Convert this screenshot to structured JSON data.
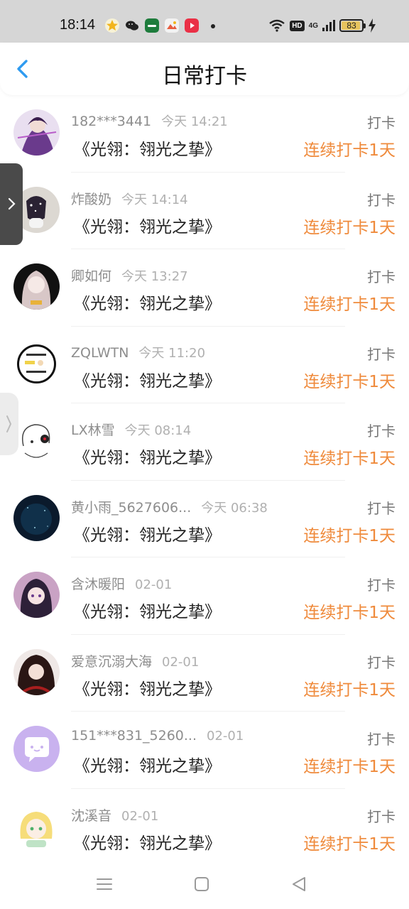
{
  "status_bar": {
    "time": "18:14",
    "battery": "83",
    "network": "4G",
    "hd": "HD",
    "app_icons": [
      "star-icon",
      "wechat-icon",
      "oppo-icon",
      "gallery-icon",
      "video-icon"
    ]
  },
  "header": {
    "title": "日常打卡",
    "back_icon": "chevron-left-icon"
  },
  "colors": {
    "accent_blue": "#2f9bf0",
    "streak_orange": "#ef8a3b"
  },
  "checkins": [
    {
      "name": "182***3441",
      "time": "今天 14:21",
      "book": "《光翎：翎光之挚》",
      "tag": "打卡",
      "streak": "连续打卡1天"
    },
    {
      "name": "炸酸奶",
      "time": "今天 14:14",
      "book": "《光翎：翎光之挚》",
      "tag": "打卡",
      "streak": "连续打卡1天"
    },
    {
      "name": "卿如何",
      "time": "今天 13:27",
      "book": "《光翎：翎光之挚》",
      "tag": "打卡",
      "streak": "连续打卡1天"
    },
    {
      "name": "ZQLWTN",
      "time": "今天 11:20",
      "book": "《光翎：翎光之挚》",
      "tag": "打卡",
      "streak": "连续打卡1天"
    },
    {
      "name": "LX林雪",
      "time": "今天 08:14",
      "book": "《光翎：翎光之挚》",
      "tag": "打卡",
      "streak": "连续打卡1天"
    },
    {
      "name": "黄小雨_5627606...",
      "time": "今天 06:38",
      "book": "《光翎：翎光之挚》",
      "tag": "打卡",
      "streak": "连续打卡1天"
    },
    {
      "name": "含沐暖阳",
      "time": "02-01",
      "book": "《光翎：翎光之挚》",
      "tag": "打卡",
      "streak": "连续打卡1天"
    },
    {
      "name": "爱意沉溺大海",
      "time": "02-01",
      "book": "《光翎：翎光之挚》",
      "tag": "打卡",
      "streak": "连续打卡1天"
    },
    {
      "name": "151***831_5260...",
      "time": "02-01",
      "book": "《光翎：翎光之挚》",
      "tag": "打卡",
      "streak": "连续打卡1天"
    },
    {
      "name": "沈溪音",
      "time": "02-01",
      "book": "《光翎：翎光之挚》",
      "tag": "打卡",
      "streak": "连续打卡1天"
    }
  ],
  "nav_bar": [
    "menu-icon",
    "home-square-icon",
    "back-triangle-icon"
  ]
}
